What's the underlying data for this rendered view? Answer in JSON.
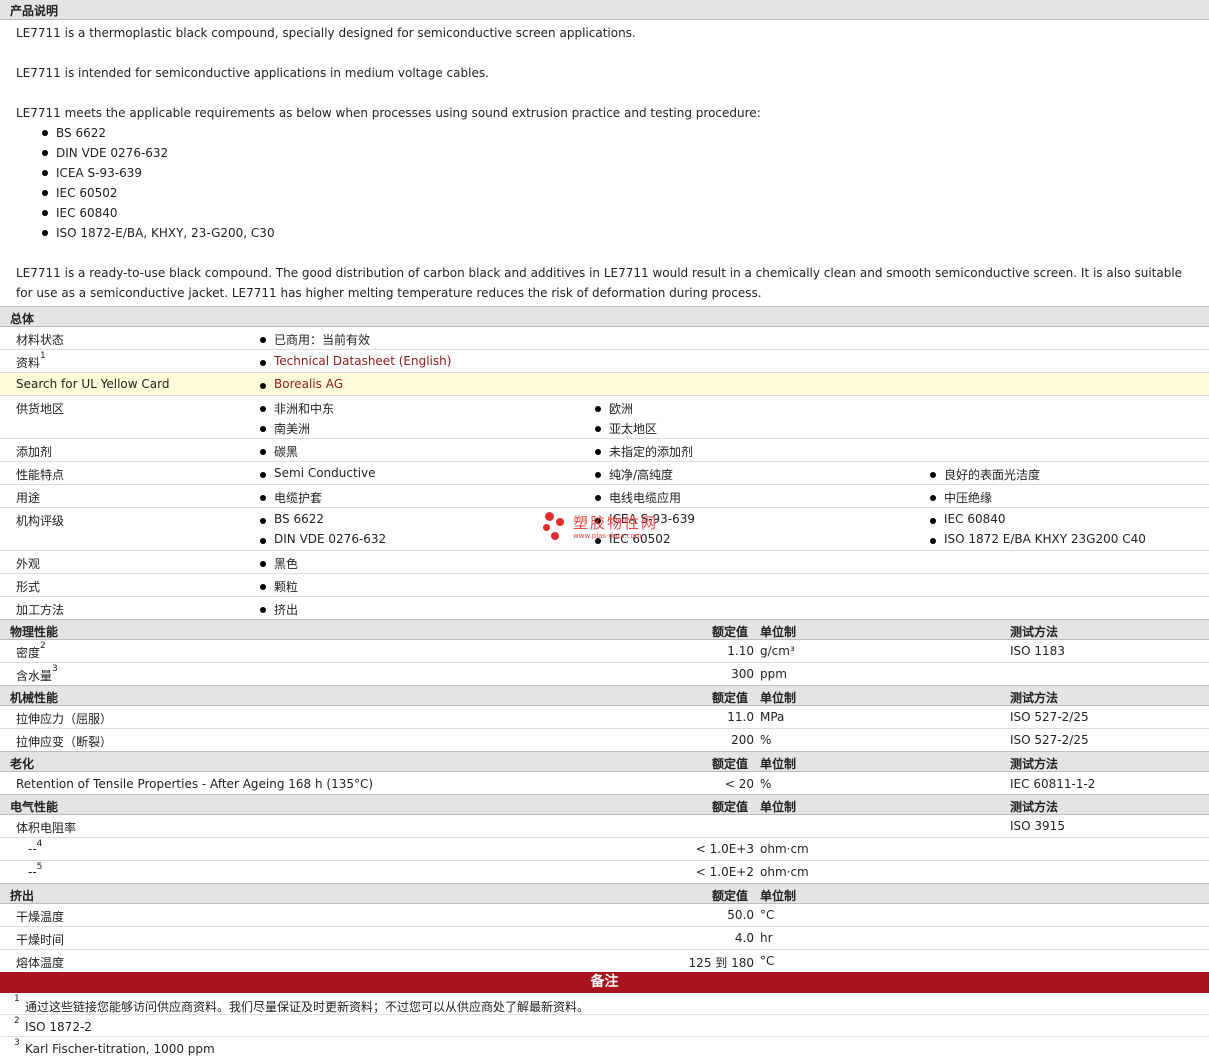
{
  "product_desc": {
    "title": "产品说明",
    "p1": "LE7711 is a thermoplastic black compound, specially designed for semiconductive screen applications.",
    "p2": "LE7711 is intended for semiconductive applications in medium voltage cables.",
    "p3": "LE7711 meets the applicable requirements as below when processes using sound extrusion practice and testing procedure:",
    "standards": [
      "BS 6622",
      "DIN VDE 0276-632",
      "ICEA S-93-639",
      "IEC 60502",
      "IEC 60840",
      "ISO 1872-E/BA, KHXY, 23-G200, C30"
    ],
    "p4": "LE7711 is a ready-to-use black compound. The good distribution of carbon black and additives in LE7711 would result in a chemically clean and smooth semiconductive screen. It is also suitable for use as a semiconductive jacket. LE7711 has higher melting temperature reduces the risk of deformation during process."
  },
  "general": {
    "title": "总体",
    "material_status": {
      "label": "材料状态",
      "value": "已商用：当前有效"
    },
    "documents": {
      "label": "资料",
      "sup": "1",
      "value": "Technical Datasheet (English)"
    },
    "ul": {
      "label": "Search for UL Yellow Card",
      "value": "Borealis AG"
    },
    "supply": {
      "label": "供货地区",
      "values": [
        "非洲和中东",
        "欧洲",
        "南美洲",
        "亚太地区"
      ]
    },
    "additive": {
      "label": "添加剂",
      "values": [
        "碳黑",
        "未指定的添加剂"
      ]
    },
    "features": {
      "label": "性能特点",
      "values": [
        "Semi Conductive",
        "纯净/高纯度",
        "良好的表面光洁度"
      ]
    },
    "uses": {
      "label": "用途",
      "values": [
        "电缆护套",
        "电线电缆应用",
        "中压绝缘"
      ]
    },
    "agency": {
      "label": "机构评级",
      "values": [
        "BS 6622",
        "DIN VDE 0276-632",
        "ICEA S-93-639",
        "IEC 60502",
        "IEC 60840",
        "ISO 1872 E/BA KHXY 23G200 C40"
      ]
    },
    "appearance": {
      "label": "外观",
      "value": "黑色"
    },
    "form": {
      "label": "形式",
      "value": "颗粒"
    },
    "processing": {
      "label": "加工方法",
      "value": "挤出"
    }
  },
  "col_headers": {
    "nominal": "额定值",
    "unit": "单位制",
    "method": "测试方法"
  },
  "physical": {
    "title": "物理性能",
    "rows": [
      {
        "label": "密度",
        "sup": "2",
        "value": "1.10",
        "unit": "g/cm³",
        "method": "ISO 1183"
      },
      {
        "label": "含水量",
        "sup": "3",
        "value": "300",
        "unit": "ppm",
        "method": ""
      }
    ]
  },
  "mechanical": {
    "title": "机械性能",
    "rows": [
      {
        "label": "拉伸应力（屈服）",
        "value": "11.0",
        "unit": "MPa",
        "method": "ISO 527-2/25"
      },
      {
        "label": "拉伸应变（断裂）",
        "value": "200",
        "unit": "%",
        "method": "ISO 527-2/25"
      }
    ]
  },
  "aging": {
    "title": "老化",
    "rows": [
      {
        "label": "Retention of Tensile Properties - After Ageing 168 h (135°C)",
        "value": "< 20",
        "unit": "%",
        "method": "IEC 60811-1-2"
      }
    ]
  },
  "electrical": {
    "title": "电气性能",
    "rows": [
      {
        "label": "体积电阻率",
        "value": "",
        "unit": "",
        "method": "ISO 3915"
      },
      {
        "label": "--",
        "sup": "4",
        "value": "< 1.0E+3",
        "unit": "ohm·cm",
        "method": ""
      },
      {
        "label": "--",
        "sup": "5",
        "value": "< 1.0E+2",
        "unit": "ohm·cm",
        "method": ""
      }
    ]
  },
  "extrusion": {
    "title": "挤出",
    "rows": [
      {
        "label": "干燥温度",
        "value": "50.0",
        "unit": "°C"
      },
      {
        "label": "干燥时间",
        "value": "4.0",
        "unit": "hr"
      },
      {
        "label": "熔体温度",
        "value": "125 到 180",
        "unit": "°C"
      }
    ]
  },
  "notes": {
    "title": "备注",
    "items": [
      {
        "n": "1",
        "text": "通过这些链接您能够访问供应商资料。我们尽量保证及时更新资料；不过您可以从供应商处了解最新资料。"
      },
      {
        "n": "2",
        "text": "ISO 1872-2"
      },
      {
        "n": "3",
        "text": "Karl Fischer-titration, 1000 ppm"
      }
    ]
  },
  "watermark": {
    "text": "塑胶物性网",
    "url": "www.plas-data.com"
  }
}
